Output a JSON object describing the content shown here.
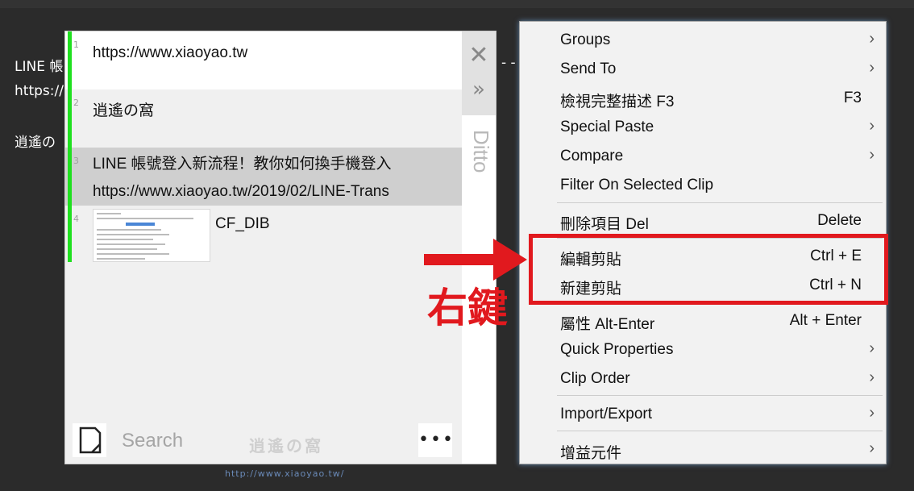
{
  "background": {
    "line1": "LINE 帳",
    "line2": "https://",
    "line3": "逍遙の",
    "right_fragment": "- -"
  },
  "ditto": {
    "side_label": "Ditto",
    "search_placeholder": "Search",
    "more_label": "•••",
    "watermark": "逍遙の窩",
    "watermark_sub": "http://www.xiaoyao.tw/",
    "clips": [
      {
        "index": "1",
        "lines": [
          "https://www.xiaoyao.tw"
        ]
      },
      {
        "index": "2",
        "lines": [
          "逍遙の窩"
        ]
      },
      {
        "index": "3",
        "lines": [
          "LINE 帳號登入新流程！教你如何換手機登入",
          "https://www.xiaoyao.tw/2019/02/LINE-Trans"
        ]
      },
      {
        "index": "4",
        "lines": [
          "CF_DIB"
        ]
      }
    ]
  },
  "context_menu": {
    "items": [
      {
        "label": "Groups",
        "shortcut": "",
        "submenu": true
      },
      {
        "label": "Send To",
        "shortcut": "",
        "submenu": true
      },
      {
        "label": "檢視完整描述 F3",
        "shortcut": "F3",
        "submenu": false
      },
      {
        "label": "Special Paste",
        "shortcut": "",
        "submenu": true
      },
      {
        "label": "Compare",
        "shortcut": "",
        "submenu": true
      },
      {
        "label": "Filter On Selected Clip",
        "shortcut": "",
        "submenu": false
      },
      {
        "label": "刪除項目 Del",
        "shortcut": "Delete",
        "submenu": false
      },
      {
        "label": "編輯剪貼",
        "shortcut": "Ctrl + E",
        "submenu": false
      },
      {
        "label": "新建剪貼",
        "shortcut": "Ctrl + N",
        "submenu": false
      },
      {
        "label": "屬性 Alt-Enter",
        "shortcut": "Alt + Enter",
        "submenu": false
      },
      {
        "label": "Quick Properties",
        "shortcut": "",
        "submenu": true
      },
      {
        "label": "Clip Order",
        "shortcut": "",
        "submenu": true
      },
      {
        "label": "Import/Export",
        "shortcut": "",
        "submenu": true
      },
      {
        "label": "增益元件",
        "shortcut": "",
        "submenu": true
      }
    ],
    "submenu_glyph": "›"
  },
  "annotation": {
    "text": "右鍵",
    "color": "#e1191e"
  },
  "colors": {
    "accent_green": "#1fe01f",
    "annotation_red": "#e1191e"
  }
}
